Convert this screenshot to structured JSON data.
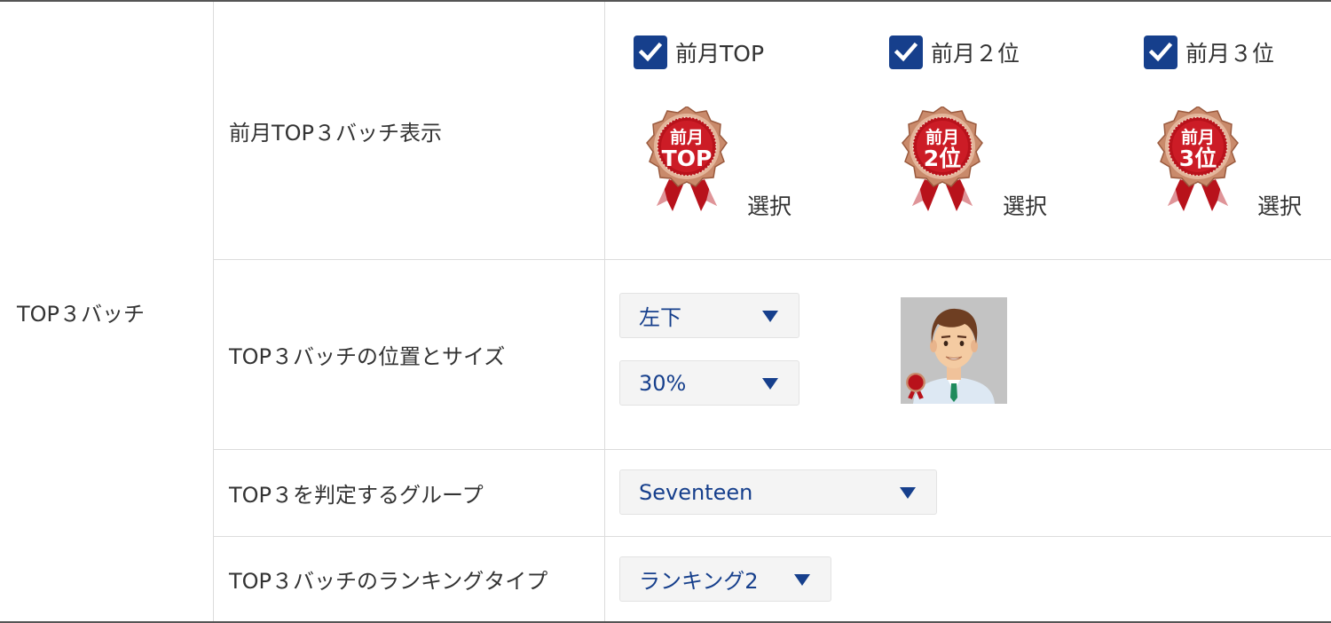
{
  "section": {
    "label": "TOP３バッチ"
  },
  "rows": {
    "display": {
      "label": "前月TOP３バッチ表示",
      "options": [
        {
          "label": "前月TOP",
          "checked": true,
          "badge_line1": "前月",
          "badge_line2": "TOP",
          "select_label": "選択"
        },
        {
          "label": "前月２位",
          "checked": true,
          "badge_line1": "前月",
          "badge_line2": "2位",
          "select_label": "選択"
        },
        {
          "label": "前月３位",
          "checked": true,
          "badge_line1": "前月",
          "badge_line2": "3位",
          "select_label": "選択"
        }
      ]
    },
    "position_size": {
      "label": "TOP３バッチの位置とサイズ",
      "position_value": "左下",
      "size_value": "30%"
    },
    "group": {
      "label": "TOP３を判定するグループ",
      "value": "Seventeen"
    },
    "ranking_type": {
      "label": "TOP３バッチのランキングタイプ",
      "value": "ランキング2"
    }
  },
  "colors": {
    "accent": "#163f8c",
    "badge_red": "#b8121b",
    "badge_bronze": "#c98a6b",
    "border": "#dcdcdc"
  },
  "icons": {
    "checkbox": "check-icon",
    "dropdown": "caret-down-icon",
    "badge": "award-rosette-icon"
  }
}
